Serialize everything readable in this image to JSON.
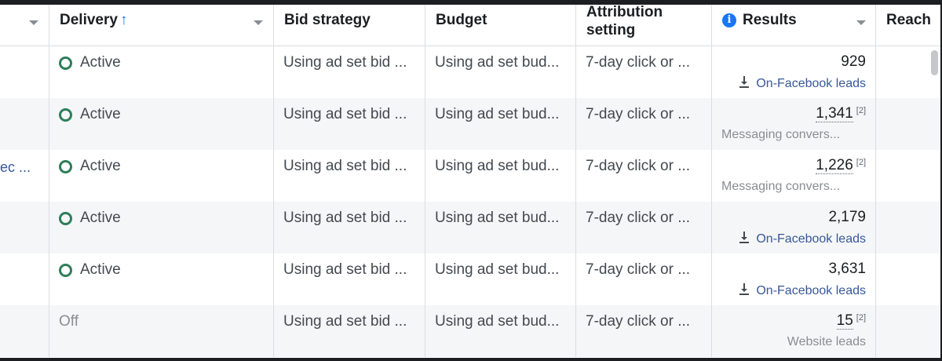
{
  "columns": {
    "delivery": "Delivery",
    "delivery_sort": "↑",
    "bid_strategy": "Bid strategy",
    "budget": "Budget",
    "attribution_line1": "Attribution",
    "attribution_line2": "setting",
    "results": "Results",
    "reach": "Reach"
  },
  "rows": [
    {
      "name": "",
      "delivery": "Active",
      "bid": "Using ad set bid ...",
      "budget": "Using ad set bud...",
      "attribution": "7-day click or ...",
      "result_value": "929",
      "result_note": "",
      "result_sub": "On-Facebook leads"
    },
    {
      "name": "",
      "delivery": "Active",
      "bid": "Using ad set bid ...",
      "budget": "Using ad set bud...",
      "attribution": "7-day click or ...",
      "result_value": "1,341",
      "result_note": "[2]",
      "result_sub": "Messaging convers..."
    },
    {
      "name": "ec ...",
      "delivery": "Active",
      "bid": "Using ad set bid ...",
      "budget": "Using ad set bud...",
      "attribution": "7-day click or ...",
      "result_value": "1,226",
      "result_note": "[2]",
      "result_sub": "Messaging convers..."
    },
    {
      "name": "",
      "delivery": "Active",
      "bid": "Using ad set bid ...",
      "budget": "Using ad set bud...",
      "attribution": "7-day click or ...",
      "result_value": "2,179",
      "result_note": "",
      "result_sub": "On-Facebook leads"
    },
    {
      "name": "",
      "delivery": "Active",
      "bid": "Using ad set bid ...",
      "budget": "Using ad set bud...",
      "attribution": "7-day click or ...",
      "result_value": "3,631",
      "result_note": "",
      "result_sub": "On-Facebook leads"
    },
    {
      "name": "",
      "delivery": "Off",
      "bid": "Using ad set bid ...",
      "budget": "Using ad set bud...",
      "attribution": "7-day click or ...",
      "result_value": "15",
      "result_note": "[2]",
      "result_sub": "Website leads"
    }
  ],
  "colors": {
    "active_status": "#2e7d5b",
    "link": "#385898",
    "sort_arrow": "#1877f2",
    "info_icon": "#1877f2"
  }
}
